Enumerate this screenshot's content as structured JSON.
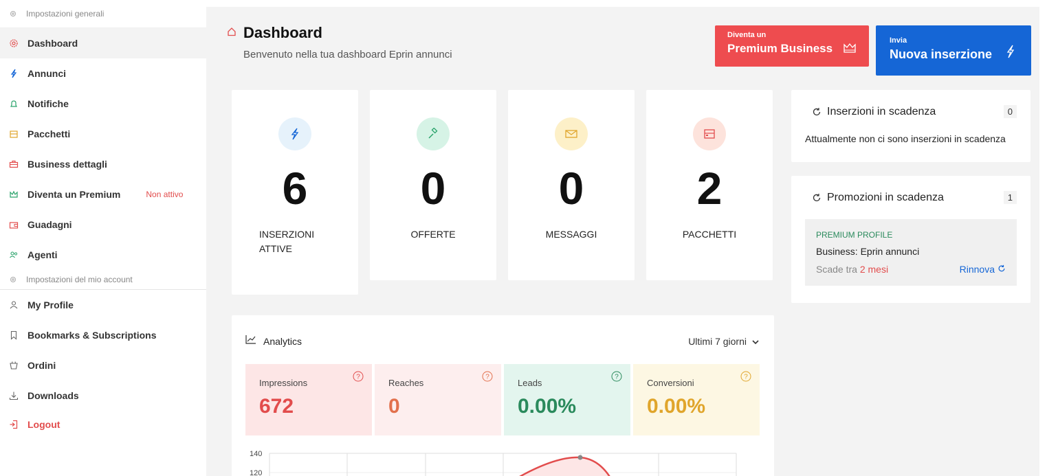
{
  "sidebar": {
    "section_general": "Impostazioni generali",
    "items": [
      {
        "label": "Dashboard",
        "icon": "gear-icon",
        "color": "#e24c4c"
      },
      {
        "label": "Annunci",
        "icon": "lightning-icon",
        "color": "#1566d6"
      },
      {
        "label": "Notifiche",
        "icon": "bell-icon",
        "color": "#2aa36b"
      },
      {
        "label": "Pacchetti",
        "icon": "package-icon",
        "color": "#e0a52b"
      },
      {
        "label": "Business dettagli",
        "icon": "briefcase-icon",
        "color": "#e24c4c"
      },
      {
        "label": "Diventa un Premium",
        "icon": "crown-icon",
        "color": "#2aa36b",
        "badge": "Non attivo"
      },
      {
        "label": "Guadagni",
        "icon": "wallet-icon",
        "color": "#e24c4c"
      },
      {
        "label": "Agenti",
        "icon": "users-icon",
        "color": "#2aa36b"
      }
    ],
    "section_account": "Impostazioni del mio account",
    "account_items": [
      {
        "label": "My Profile",
        "icon": "user-icon"
      },
      {
        "label": "Bookmarks & Subscriptions",
        "icon": "bookmark-icon"
      },
      {
        "label": "Ordini",
        "icon": "basket-icon"
      },
      {
        "label": "Downloads",
        "icon": "download-icon"
      },
      {
        "label": "Logout",
        "icon": "logout-icon"
      }
    ]
  },
  "header": {
    "title": "Dashboard",
    "subtitle": "Benvenuto nella tua dashboard Eprin annunci",
    "premium_small": "Diventa un",
    "premium_big": "Premium Business",
    "new_small": "Invia",
    "new_big": "Nuova inserzione"
  },
  "stats": [
    {
      "value": "6",
      "label_line1": "INSERZIONI",
      "label_line2": "ATTIVE",
      "icon": "lightning-icon",
      "bg": "#e6f2fb",
      "color": "#1566d6"
    },
    {
      "value": "0",
      "label_line1": "OFFERTE",
      "label_line2": "",
      "icon": "gavel-icon",
      "bg": "#d6f3e6",
      "color": "#2aa36b"
    },
    {
      "value": "0",
      "label_line1": "MESSAGGI",
      "label_line2": "",
      "icon": "envelope-icon",
      "bg": "#fdf0c8",
      "color": "#e0a52b"
    },
    {
      "value": "2",
      "label_line1": "PACCHETTI",
      "label_line2": "",
      "icon": "package-icon",
      "bg": "#fde3dc",
      "color": "#e24c4c"
    }
  ],
  "expiring": {
    "title": "Inserzioni in scadenza",
    "count": "0",
    "text": "Attualmente non ci sono inserzioni in scadenza"
  },
  "promotions": {
    "title": "Promozioni in scadenza",
    "count": "1",
    "type": "PREMIUM PROFILE",
    "business": "Business: Eprin annunci",
    "expire_prefix": "Scade tra",
    "expire_value": "2 mesi",
    "renew": "Rinnova"
  },
  "analytics": {
    "title": "Analytics",
    "period": "Ultimi 7 giorni",
    "metrics": [
      {
        "label": "Impressions",
        "value": "672",
        "bg": "#fde6e6",
        "color": "#e24c4c"
      },
      {
        "label": "Reaches",
        "value": "0",
        "bg": "#fdeeee",
        "color": "#e2704c"
      },
      {
        "label": "Leads",
        "value": "0.00%",
        "bg": "#e3f5ee",
        "color": "#2a8a5c"
      },
      {
        "label": "Conversioni",
        "value": "0.00%",
        "bg": "#fdf7e3",
        "color": "#e0a52b"
      }
    ]
  },
  "chart_data": {
    "type": "line",
    "y_ticks": [
      "140",
      "120"
    ],
    "ylim": [
      120,
      140
    ],
    "series": [
      {
        "values": [
          138
        ]
      }
    ]
  }
}
